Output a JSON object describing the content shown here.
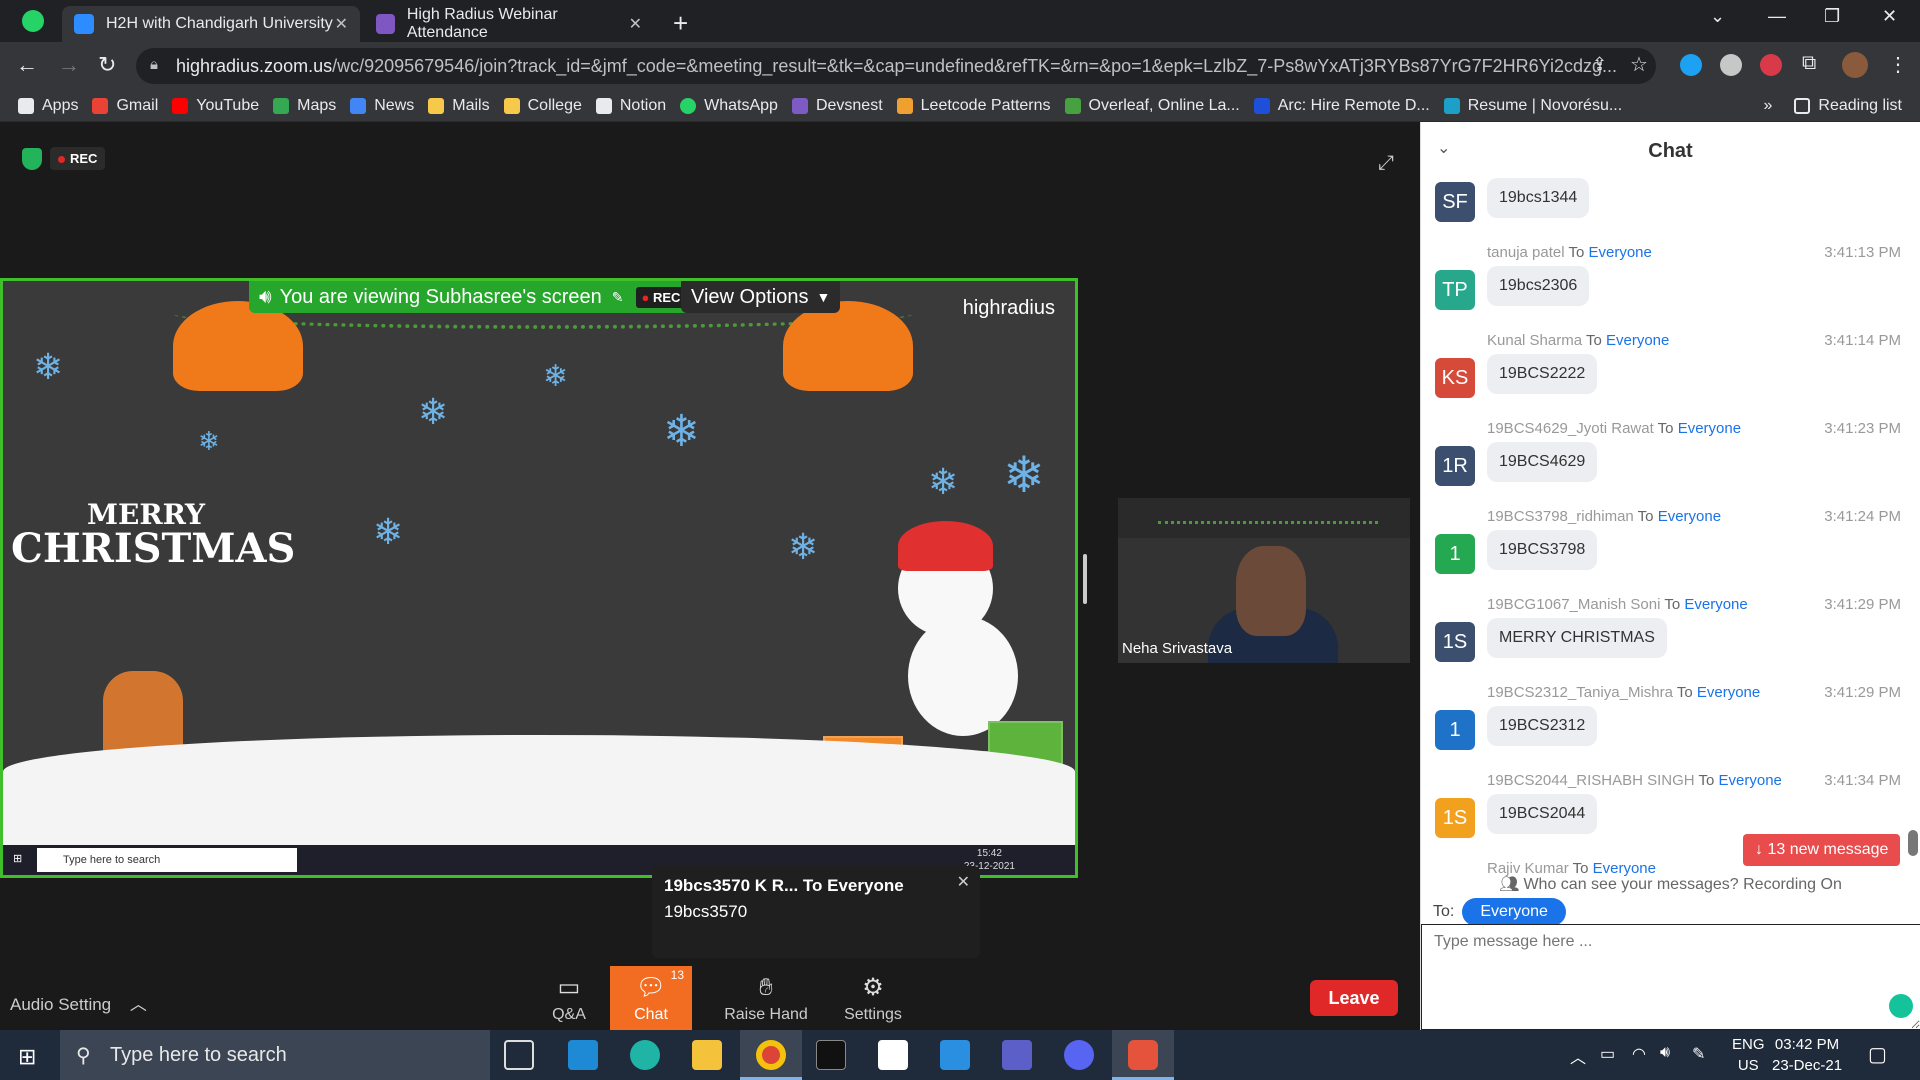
{
  "browser": {
    "tabs": [
      {
        "title": "H2H with Chandigarh University",
        "active": true
      },
      {
        "title": "High Radius Webinar Attendance",
        "active": false
      }
    ],
    "url_host": "highradius.zoom.us",
    "url_path": "/wc/92095679546/join?track_id=&jmf_code=&meeting_result=&tk=&cap=undefined&refTK=&rn=&po=1&epk=LzlbZ_7-Ps8wYxATj3RYBs87YrG7F2HR6Yi2cdzg...",
    "bookmarks": [
      "Apps",
      "Gmail",
      "YouTube",
      "Maps",
      "News",
      "Mails",
      "College",
      "Notion",
      "WhatsApp",
      "Devsnest",
      "Leetcode Patterns",
      "Overleaf, Online La...",
      "Arc: Hire Remote D...",
      "Resume | Novorésu..."
    ],
    "more": "»",
    "reading_list": "Reading list"
  },
  "zoom": {
    "rec_label": "REC",
    "viewing_text": "You are viewing Subhasree's screen",
    "viewing_rec": "REC",
    "view_options": "View Options",
    "shared_logo": "highradius",
    "merry_line1": "MERRY",
    "merry_line2": "CHRISTMAS",
    "inner_search": "Type here to search",
    "inner_time": "15:42",
    "inner_date": "23-12-2021",
    "thumbnail_name": "Neha Srivastava",
    "toast": {
      "sender": "19bcs3570 K R... To Everyone",
      "text": "19bcs3570"
    },
    "audio_setting": "Audio Setting",
    "buttons": {
      "qa": "Q&A",
      "chat": "Chat",
      "chat_badge": "13",
      "raise_hand": "Raise Hand",
      "settings": "Settings"
    },
    "leave": "Leave"
  },
  "chat": {
    "title": "Chat",
    "messages": [
      {
        "sender": "",
        "to": "",
        "recipient": "",
        "time": "",
        "initials": "SF",
        "color": "#3d4f6e",
        "text": "19bcs1344"
      },
      {
        "sender": "tanuja patel",
        "to": "To",
        "recipient": "Everyone",
        "time": "3:41:13 PM",
        "initials": "TP",
        "color": "#27a88c",
        "text": "19bcs2306"
      },
      {
        "sender": "Kunal Sharma",
        "to": "To",
        "recipient": "Everyone",
        "time": "3:41:14 PM",
        "initials": "KS",
        "color": "#d64a3a",
        "text": "19BCS2222"
      },
      {
        "sender": "19BCS4629_Jyoti Rawat",
        "to": "To",
        "recipient": "Everyone",
        "time": "3:41:23 PM",
        "initials": "1R",
        "color": "#3d4f6e",
        "text": "19BCS4629"
      },
      {
        "sender": "19BCS3798_ridhiman",
        "to": "To",
        "recipient": "Everyone",
        "time": "3:41:24 PM",
        "initials": "1",
        "color": "#24a852",
        "text": "19BCS3798"
      },
      {
        "sender": "19BCG1067_Manish Soni",
        "to": "To",
        "recipient": "Everyone",
        "time": "3:41:29 PM",
        "initials": "1S",
        "color": "#3d4f6e",
        "text": "MERRY CHRISTMAS"
      },
      {
        "sender": "19BCS2312_Taniya_Mishra",
        "to": "To",
        "recipient": "Everyone",
        "time": "3:41:29 PM",
        "initials": "1",
        "color": "#1e73c8",
        "text": "19BCS2312"
      },
      {
        "sender": "19BCS2044_RISHABH SINGH",
        "to": "To",
        "recipient": "Everyone",
        "time": "3:41:34 PM",
        "initials": "1S",
        "color": "#f2a11f",
        "text": "19BCS2044"
      },
      {
        "sender": "Rajiv Kumar",
        "to": "To",
        "recipient": "Everyone",
        "time": "",
        "initials": "",
        "color": "#ffffff",
        "text": ""
      }
    ],
    "new_messages": "↓ 13 new message",
    "who_can_see": "Who can see your messages? Recording On",
    "to_label": "To:",
    "to_value": "Everyone",
    "input_placeholder": "Type message here ..."
  },
  "taskbar": {
    "search": "Type here to search",
    "lang1": "ENG",
    "lang2": "US",
    "time": "03:42 PM",
    "date": "23-Dec-21"
  }
}
